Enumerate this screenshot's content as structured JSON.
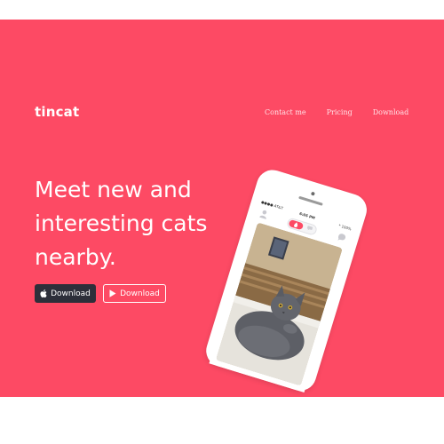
{
  "brand": {
    "name": "tincat"
  },
  "nav": {
    "items": [
      {
        "label": "Contact me"
      },
      {
        "label": "Pricing"
      },
      {
        "label": "Download"
      }
    ]
  },
  "hero": {
    "headline_lines": [
      "Meet new and",
      "interesting cats",
      "nearby."
    ],
    "buttons": {
      "app_store_label": "Download",
      "play_store_label": "Download"
    },
    "colors": {
      "background": "#fd4a64",
      "dark_button": "#2d2f3a"
    }
  },
  "phone": {
    "status": {
      "carrier": "●●●● AT&T",
      "time": "6:05 PM",
      "battery": "* 100%"
    },
    "photo_subject": "grey-cat-on-couch"
  }
}
